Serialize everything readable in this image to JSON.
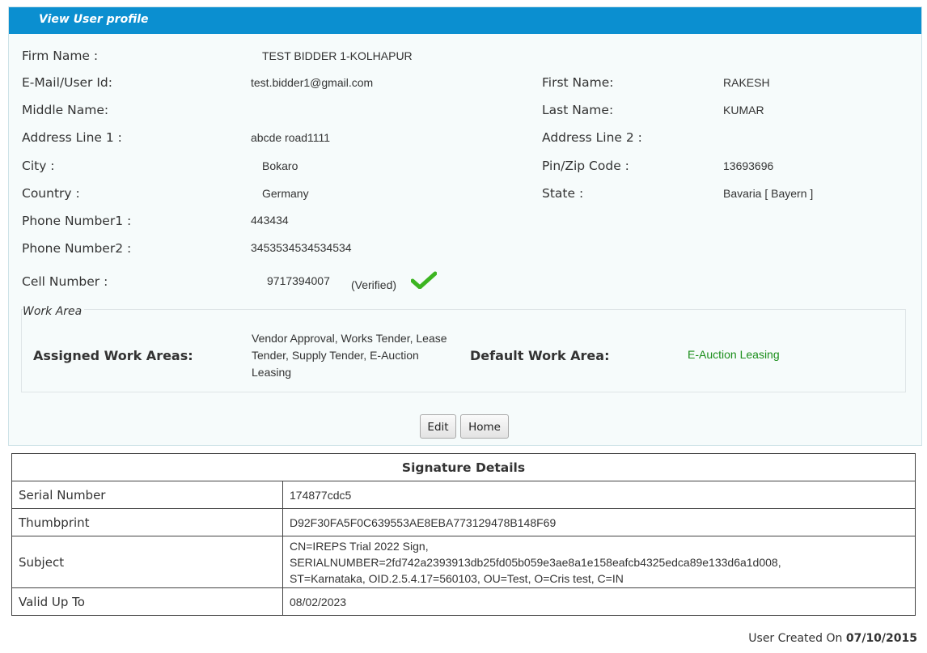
{
  "header": {
    "title": "View User profile"
  },
  "profile": {
    "firm_name_label": "Firm Name :",
    "firm_name": "TEST BIDDER 1-KOLHAPUR",
    "email_label": "E-Mail/User Id:",
    "email": "test.bidder1@gmail.com",
    "first_name_label": "First Name:",
    "first_name": "RAKESH",
    "middle_name_label": "Middle Name:",
    "middle_name": "",
    "last_name_label": "Last Name:",
    "last_name": "KUMAR",
    "address1_label": "Address Line 1 :",
    "address1": "abcde road1111",
    "address2_label": "Address Line 2 :",
    "address2": "",
    "city_label": "City :",
    "city": "Bokaro",
    "pin_label": "Pin/Zip Code :",
    "pin": "13693696",
    "country_label": "Country :",
    "country": "Germany",
    "state_label": "State :",
    "state": "Bavaria [ Bayern ]",
    "phone1_label": "Phone Number1 :",
    "phone1": "443434",
    "phone2_label": "Phone Number2 :",
    "phone2": "3453534534534534",
    "cell_label": "Cell Number :",
    "cell": "9717394007",
    "cell_status": "(Verified)",
    "verified_icon": "checkmark-icon",
    "verified_color": "#3cb521"
  },
  "work_area": {
    "legend": "Work Area",
    "assigned_label": "Assigned Work Areas:",
    "assigned": "Vendor Approval, Works Tender, Lease Tender, Supply Tender, E-Auction Leasing",
    "default_label": "Default Work Area:",
    "default": "E-Auction Leasing",
    "default_color": "#1b8e1b"
  },
  "buttons": {
    "edit": "Edit",
    "home": "Home"
  },
  "signature": {
    "title": "Signature Details",
    "serial_label": "Serial Number",
    "serial": "174877cdc5",
    "thumbprint_label": "Thumbprint",
    "thumbprint": "D92F30FA5F0C639553AE8EBA773129478B148F69",
    "subject_label": "Subject",
    "subject_line1": "CN=IREPS Trial 2022 Sign,",
    "subject_line2": "SERIALNUMBER=2fd742a2393913db25fd05b059e3ae8a1e158eafcb4325edca89e133d6a1d008,",
    "subject_line3": "ST=Karnataka, OID.2.5.4.17=560103, OU=Test, O=Cris test, C=IN",
    "valid_label": "Valid Up To",
    "valid": "08/02/2023"
  },
  "footer": {
    "created_label": "User Created On",
    "created_date": "07/10/2015"
  },
  "colors": {
    "header_bg": "#0b8fd0",
    "panel_bg": "#f6fbfb"
  }
}
